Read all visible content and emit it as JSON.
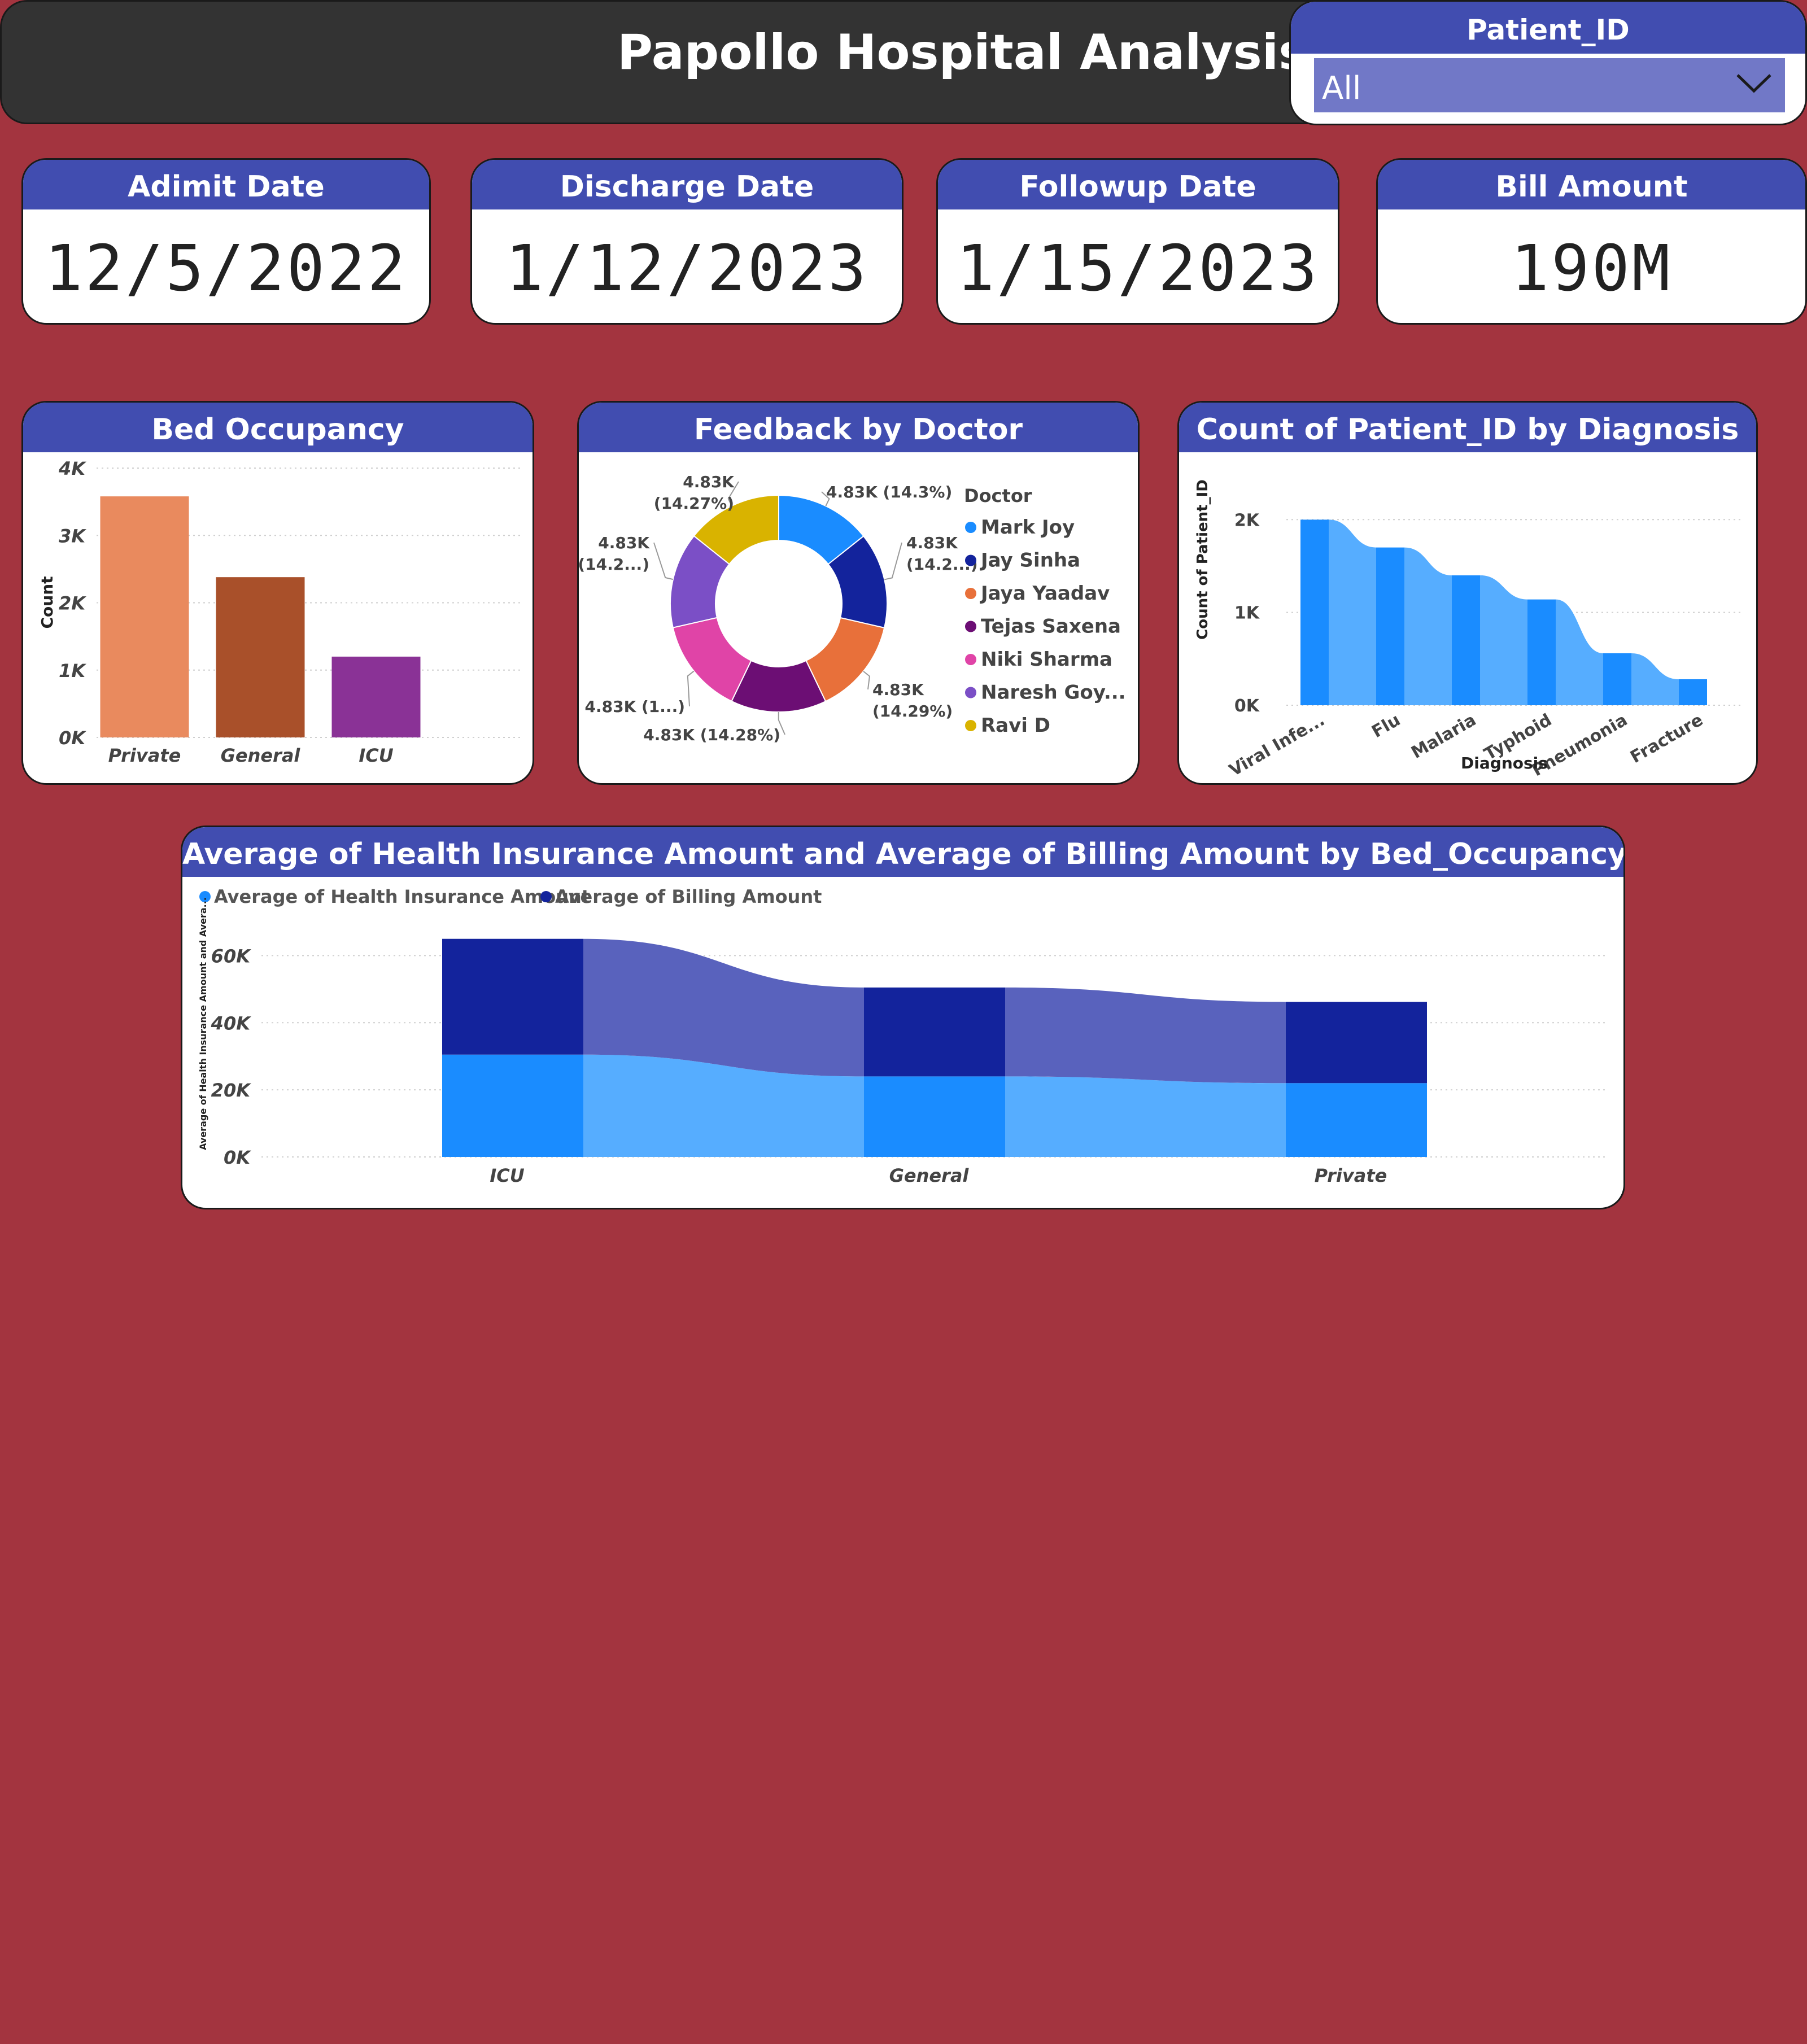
{
  "header": {
    "title": "Papollo Hospital Analysis"
  },
  "slicer": {
    "label": "Patient_ID",
    "value": "All"
  },
  "kpis": [
    {
      "label": "Adimit Date",
      "value": "12/5/2022"
    },
    {
      "label": "Discharge Date",
      "value": "1/12/2023"
    },
    {
      "label": "Followup Date",
      "value": "1/15/2023"
    },
    {
      "label": "Bill Amount",
      "value": "190M"
    }
  ],
  "colors": {
    "background": "#a3343f",
    "header": "#414db0",
    "title_bar": "#333333"
  },
  "chart_data": [
    {
      "id": "bed-occupancy",
      "type": "bar",
      "title": "Bed Occupancy",
      "ylabel": "Count",
      "xlabel": "",
      "categories": [
        "Private",
        "General",
        "ICU"
      ],
      "values": [
        3580,
        2380,
        1200
      ],
      "colors": [
        "#e98a5e",
        "#a9502a",
        "#8a3296"
      ],
      "ylim": [
        0,
        4000
      ],
      "yticks": [
        "0K",
        "1K",
        "2K",
        "3K",
        "4K"
      ],
      "grid": true
    },
    {
      "id": "feedback-by-doctor",
      "type": "pie",
      "title": "Feedback by Doctor",
      "legend_title": "Doctor",
      "legend_position": "right",
      "series": [
        {
          "name": "Mark Joy",
          "value": 14.3,
          "color": "#1a8cff",
          "label": "4.83K (14.3%)"
        },
        {
          "name": "Jay Sinha",
          "value": 14.28,
          "color": "#13239c",
          "label": "4.83K (14.2...)"
        },
        {
          "name": "Jaya Yaadav",
          "value": 14.29,
          "color": "#e8703a",
          "label": "4.83K (14.29%)"
        },
        {
          "name": "Tejas Saxena",
          "value": 14.28,
          "color": "#6c0e74",
          "label": "4.83K (14.28%)"
        },
        {
          "name": "Niki Sharma",
          "value": 14.28,
          "color": "#e044a7",
          "label": "4.83K (1...)"
        },
        {
          "name": "Naresh Goy...",
          "value": 14.28,
          "color": "#7b4fc6",
          "label": "4.83K (14.2...)"
        },
        {
          "name": "Ravi D",
          "value": 14.27,
          "color": "#d9b300",
          "label": "4.83K (14.27%)"
        }
      ]
    },
    {
      "id": "patients-by-diagnosis",
      "type": "bar",
      "title": "Count of Patient_ID by Diagnosis",
      "xlabel": "Diagnosis",
      "ylabel": "Count of Patient_ID",
      "categories": [
        "Viral Infe...",
        "Flu",
        "Malaria",
        "Typhoid",
        "Pneumonia",
        "Fracture"
      ],
      "values": [
        2000,
        1700,
        1400,
        1140,
        560,
        280
      ],
      "ylim": [
        0,
        2300
      ],
      "yticks": [
        "0K",
        "1K",
        "2K"
      ],
      "grid": true
    },
    {
      "id": "insurance-vs-billing",
      "type": "bar",
      "title": "Average of Health Insurance Amount and Average of Billing Amount by Bed_Occupancy",
      "xlabel": "",
      "ylabel": "Average of Health Insurance Amount and Avera...",
      "categories": [
        "ICU",
        "General",
        "Private"
      ],
      "series": [
        {
          "name": "Average of Health Insurance Amount",
          "values": [
            30500,
            24000,
            22000
          ],
          "color": "#1a8cff"
        },
        {
          "name": "Average of Billing Amount",
          "values": [
            34500,
            26500,
            24200
          ],
          "color": "#13239c"
        }
      ],
      "stacked": true,
      "ylim": [
        0,
        70000
      ],
      "yticks": [
        "0K",
        "20K",
        "40K",
        "60K"
      ],
      "legend_position": "top-left",
      "grid": true
    }
  ]
}
